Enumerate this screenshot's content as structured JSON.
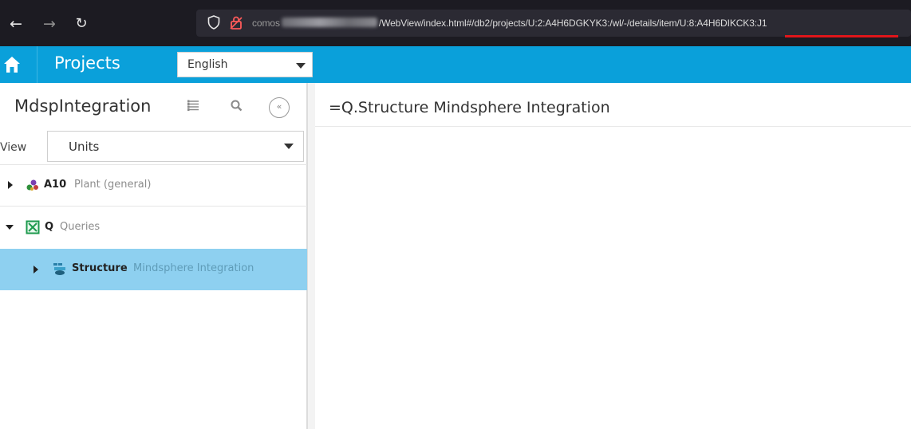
{
  "browser": {
    "url_prefix": "comos",
    "url_middle": "/WebView/index.html#/db2/projects/U:2:A4H6DGKYK3:/wl/-/details/item/",
    "url_highlight": "U:8:A4H6DIKCK3:J1",
    "icons": [
      "back-arrow-icon",
      "forward-arrow-icon",
      "reload-icon",
      "shield-icon",
      "lock-icon"
    ],
    "highlight_color": "#e0151a"
  },
  "header": {
    "title": "Projects",
    "language": "English",
    "accent_color": "#0aa0da"
  },
  "sidebar": {
    "title": "MdspIntegration",
    "view_label": "View",
    "view_value": "Units",
    "tree": [
      {
        "name": "A10",
        "description": "Plant (general)",
        "expanded": false,
        "icon": "plant-icon"
      },
      {
        "name": "Q",
        "description": "Queries",
        "expanded": true,
        "icon": "query-icon"
      },
      {
        "name": "Structure",
        "description": "Mindsphere Integration",
        "expanded": false,
        "selected": true,
        "icon": "structure-icon"
      }
    ],
    "selected_color": "#8ed0f0"
  },
  "main": {
    "title": "=Q.Structure Mindsphere Integration"
  }
}
